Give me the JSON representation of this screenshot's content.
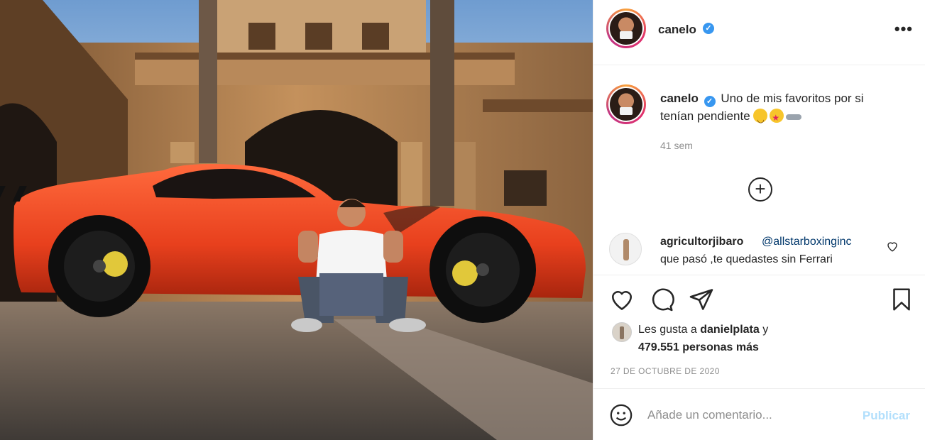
{
  "post": {
    "username": "canelo",
    "verified": true,
    "more_icon": "more-options-icon"
  },
  "caption": {
    "username": "canelo",
    "text": "Uno de mis favoritos por si tenían pendiente",
    "time_ago": "41 sem"
  },
  "comments": [
    {
      "username": "agricultorjibaro",
      "mention": "@allstarboxinginc",
      "text": "que pasó ,te quedastes sin Ferrari"
    }
  ],
  "actions": {
    "icons": [
      "heart-icon",
      "comment-icon",
      "share-icon",
      "bookmark-icon"
    ]
  },
  "likes": {
    "prefix": "Les gusta a",
    "liked_by": "danielplata",
    "connector": "y",
    "others": "479.551 personas más"
  },
  "date": "27 DE OCTUBRE DE 2020",
  "add_comment": {
    "placeholder": "Añade un comentario...",
    "post_label": "Publicar"
  },
  "colors": {
    "link": "#00376b",
    "verified": "#3897f0",
    "post_disabled": "#b2dffc",
    "muted": "#8e8e8e"
  }
}
